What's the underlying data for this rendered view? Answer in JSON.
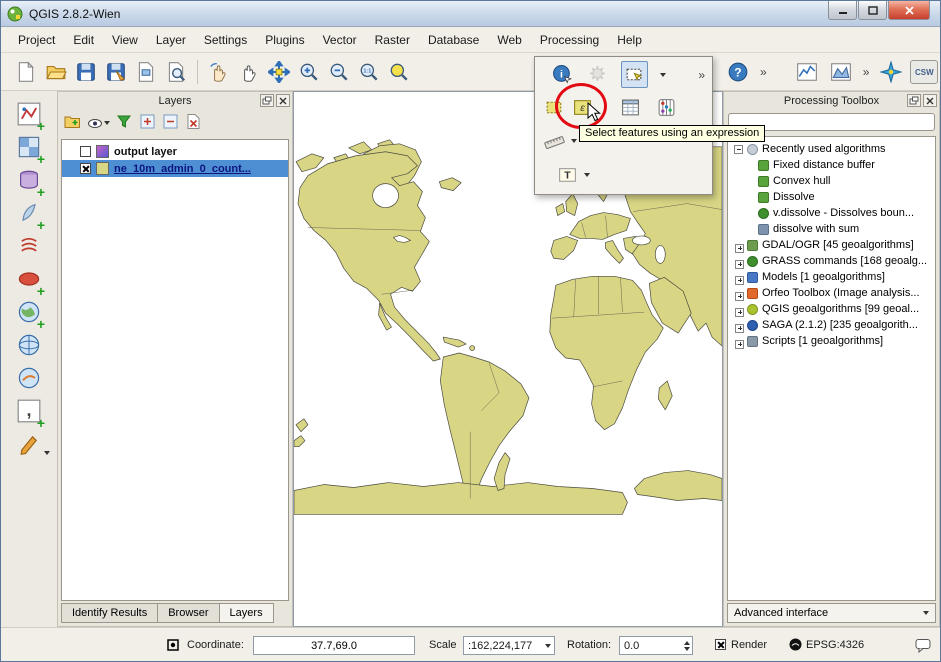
{
  "window": {
    "title": "QGIS 2.8.2-Wien"
  },
  "menu": {
    "items": [
      "Project",
      "Edit",
      "View",
      "Layer",
      "Settings",
      "Plugins",
      "Vector",
      "Raster",
      "Database",
      "Web",
      "Processing",
      "Help"
    ]
  },
  "toolbar": {
    "overflow_chevron": "»"
  },
  "icons": {
    "identify": "i",
    "help": "?",
    "expression": "ε",
    "text_annotation": "T",
    "zoom_native": "1:1",
    "csw": "CSW",
    "delimited_comma": ","
  },
  "popup": {
    "tooltip": "Select features using an expression"
  },
  "layers_panel": {
    "title": "Layers",
    "rows": [
      {
        "name": "output layer"
      },
      {
        "name": "ne_10m_admin_0_count..."
      }
    ],
    "tabs": [
      "Identify Results",
      "Browser",
      "Layers"
    ]
  },
  "processing_panel": {
    "title": "Processing Toolbox",
    "tree": [
      {
        "label": "Recently used algorithms"
      },
      {
        "label": "Fixed distance buffer"
      },
      {
        "label": "Convex hull"
      },
      {
        "label": "Dissolve"
      },
      {
        "label": "v.dissolve - Dissolves boun..."
      },
      {
        "label": "dissolve with sum"
      },
      {
        "label": "GDAL/OGR [45 geoalgorithms]"
      },
      {
        "label": "GRASS commands [168 geoalg..."
      },
      {
        "label": "Models [1 geoalgorithms]"
      },
      {
        "label": "Orfeo Toolbox (Image analysis..."
      },
      {
        "label": "QGIS geoalgorithms [99 geoal..."
      },
      {
        "label": "SAGA (2.1.2) [235 geoalgorith..."
      },
      {
        "label": "Scripts [1 geoalgorithms]"
      }
    ],
    "footer": "Advanced interface"
  },
  "statusbar": {
    "coordinate_label": "Coordinate:",
    "coordinate_value": "37.7,69.0",
    "scale_label": "Scale",
    "scale_value": ":162,224,177",
    "rotation_label": "Rotation:",
    "rotation_value": "0.0",
    "render_label": "Render",
    "crs_label": "EPSG:4326"
  }
}
